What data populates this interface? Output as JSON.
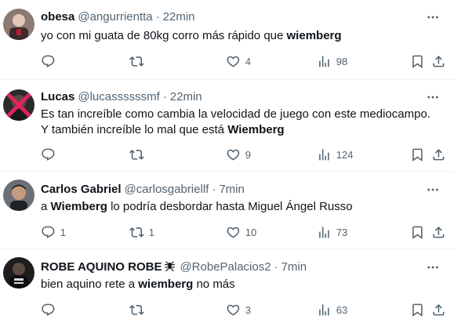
{
  "tweets": [
    {
      "name": "obesa",
      "handle": "@angurrientta",
      "separator": "·",
      "time": "22min",
      "text_before": "yo con mi guata de 80kg corro más rápido que ",
      "text_bold": "wiemberg",
      "replies": "",
      "retweets": "",
      "likes": "4",
      "views": "98"
    },
    {
      "name": "Lucas",
      "handle": "@lucassssssmf",
      "separator": "·",
      "time": "22min",
      "line1": "Es tan increíble como cambia la  velocidad de juego con este mediocampo.",
      "line2_before": "Y también increíble lo mal que está ",
      "text_bold": "Wiemberg",
      "replies": "",
      "retweets": "",
      "likes": "9",
      "views": "124"
    },
    {
      "name": "Carlos Gabriel",
      "handle": "@carlosgabriellf",
      "separator": "·",
      "time": "7min",
      "text_before": "a ",
      "text_bold": "Wiemberg",
      "text_after": " lo podría desbordar hasta Miguel Ángel Russo",
      "replies": "1",
      "retweets": "1",
      "likes": "10",
      "views": "73"
    },
    {
      "name": "ROBE AQUINO ROBE",
      "handle": "@RobePalacios2",
      "separator": "·",
      "time": "7min",
      "text_before": "bien aquino rete a ",
      "text_bold": "wiemberg",
      "text_after": " no más",
      "replies": "",
      "retweets": "",
      "likes": "3",
      "views": "63"
    }
  ],
  "icons": {
    "reply": "reply-icon",
    "retweet": "retweet-icon",
    "like": "heart-icon",
    "views": "views-chart-icon",
    "bookmark": "bookmark-icon",
    "share": "share-icon",
    "more": "more-icon",
    "name_badge": "spider-icon"
  },
  "colors": {
    "text": "#0f1419",
    "secondary": "#536471",
    "divider": "#eff3f4"
  }
}
